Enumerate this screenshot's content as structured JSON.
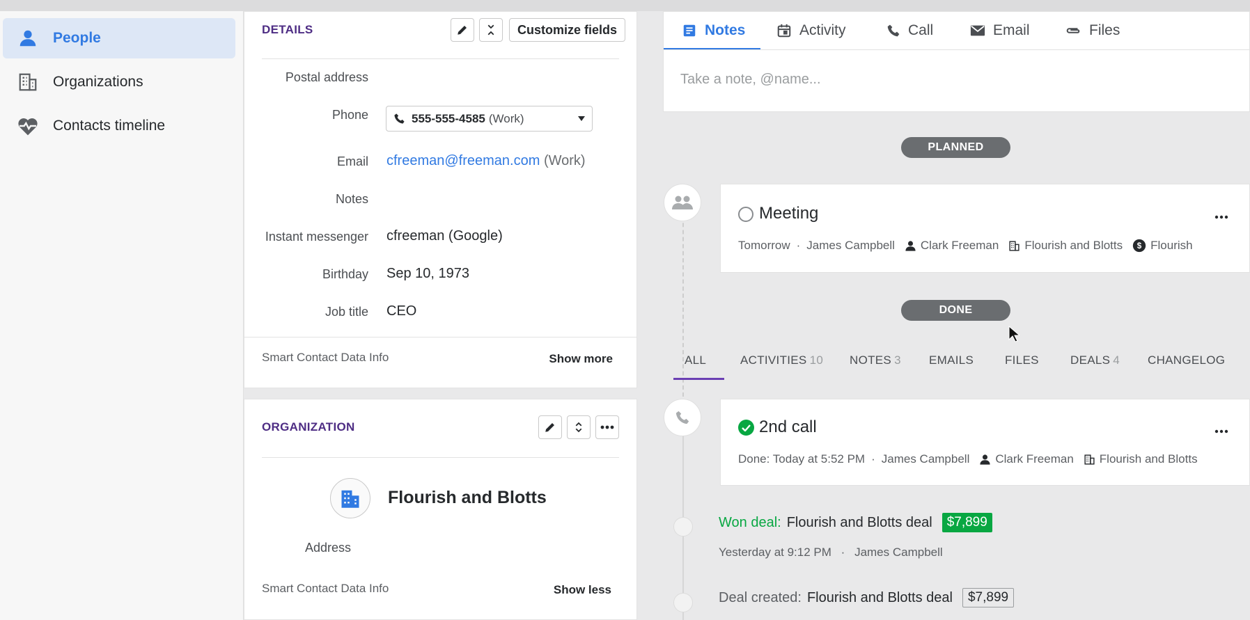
{
  "sidebar": {
    "items": [
      {
        "label": "People",
        "icon": "person-icon",
        "active": true
      },
      {
        "label": "Organizations",
        "icon": "building-icon",
        "active": false
      },
      {
        "label": "Contacts timeline",
        "icon": "heartbeat-icon",
        "active": false
      }
    ]
  },
  "details": {
    "title": "DETAILS",
    "customize_label": "Customize fields",
    "fields": {
      "postal_address_label": "Postal address",
      "phone_label": "Phone",
      "phone_number": "555-555-4585",
      "phone_type": "(Work)",
      "email_label": "Email",
      "email_value": "cfreeman@freeman.com",
      "email_type": "(Work)",
      "notes_label": "Notes",
      "im_label": "Instant messenger",
      "im_value": "cfreeman (Google)",
      "birthday_label": "Birthday",
      "birthday_value": "Sep 10, 1973",
      "job_title_label": "Job title",
      "job_title_value": "CEO"
    },
    "smart_info": "Smart Contact Data Info",
    "show_more": "Show more"
  },
  "organization": {
    "title": "ORGANIZATION",
    "name": "Flourish and Blotts",
    "address_label": "Address",
    "smart_info": "Smart Contact Data Info",
    "show_less": "Show less"
  },
  "composer": {
    "tabs": [
      {
        "label": "Notes",
        "active": true
      },
      {
        "label": "Activity",
        "active": false
      },
      {
        "label": "Call",
        "active": false
      },
      {
        "label": "Email",
        "active": false
      },
      {
        "label": "Files",
        "active": false
      }
    ],
    "placeholder": "Take a note, @name..."
  },
  "timeline": {
    "planned_label": "PLANNED",
    "done_label": "DONE",
    "meeting": {
      "title": "Meeting",
      "when": "Tomorrow",
      "sep": "·",
      "owner": "James Campbell",
      "person": "Clark Freeman",
      "org": "Flourish and Blotts",
      "deal": "Flourish"
    },
    "filters": [
      {
        "label": "ALL",
        "count": ""
      },
      {
        "label": "ACTIVITIES",
        "count": "10"
      },
      {
        "label": "NOTES",
        "count": "3"
      },
      {
        "label": "EMAILS",
        "count": ""
      },
      {
        "label": "FILES",
        "count": ""
      },
      {
        "label": "DEALS",
        "count": "4"
      },
      {
        "label": "CHANGELOG",
        "count": ""
      }
    ],
    "call": {
      "title": "2nd call",
      "when": "Done: Today at 5:52 PM",
      "sep": "·",
      "owner": "James Campbell",
      "person": "Clark Freeman",
      "org": "Flourish and Blotts"
    },
    "won_deal": {
      "label": "Won deal:",
      "name": "Flourish and Blotts deal",
      "amount": "$7,899",
      "when": "Yesterday at 9:12 PM",
      "sep": "·",
      "owner": "James Campbell"
    },
    "deal_created": {
      "label": "Deal created:",
      "name": "Flourish and Blotts deal",
      "amount": "$7,899"
    }
  },
  "colors": {
    "accent": "#317ae2",
    "section_title": "#4e2d84",
    "success": "#08a742",
    "pill": "#6a6d70"
  }
}
